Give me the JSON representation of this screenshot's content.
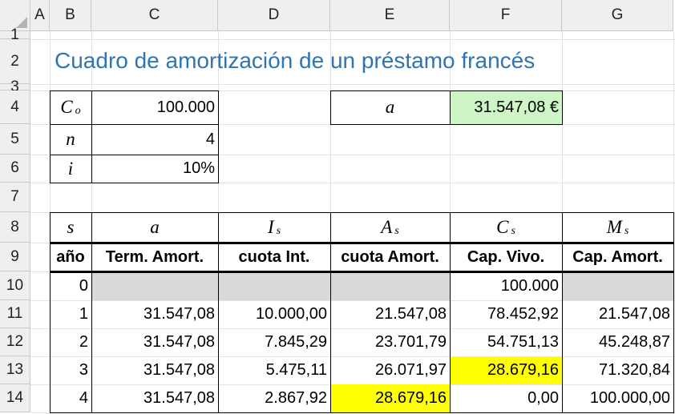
{
  "sheet": {
    "columns": [
      "A",
      "B",
      "C",
      "D",
      "E",
      "F",
      "G"
    ],
    "rows": [
      "1",
      "2",
      "3",
      "4",
      "5",
      "6",
      "7",
      "8",
      "9",
      "10",
      "11",
      "12",
      "13",
      "14"
    ],
    "title": "Cuadro de amortización de un préstamo francés",
    "params": [
      {
        "sym": "C",
        "sub": "o",
        "value": "100.000"
      },
      {
        "sym": "n",
        "sub": "",
        "value": "4"
      },
      {
        "sym": "i",
        "sub": "",
        "value": "10%"
      }
    ],
    "annuity": {
      "sym": "a",
      "value": "31.547,08 €"
    },
    "table": {
      "symbols": [
        {
          "sym": "s",
          "sub": ""
        },
        {
          "sym": "a",
          "sub": ""
        },
        {
          "sym": "I",
          "sub": "s"
        },
        {
          "sym": "A",
          "sub": "s"
        },
        {
          "sym": "C",
          "sub": "s"
        },
        {
          "sym": "M",
          "sub": "s"
        }
      ],
      "headers": [
        "año",
        "Term. Amort.",
        "cuota Int.",
        "cuota Amort.",
        "Cap. Vivo.",
        "Cap. Amort."
      ],
      "rows": [
        [
          "0",
          "",
          "",
          "",
          "100.000",
          ""
        ],
        [
          "1",
          "31.547,08",
          "10.000,00",
          "21.547,08",
          "78.452,92",
          "21.547,08"
        ],
        [
          "2",
          "31.547,08",
          "7.845,29",
          "23.701,79",
          "54.751,13",
          "45.248,87"
        ],
        [
          "3",
          "31.547,08",
          "5.475,11",
          "26.071,97",
          "28.679,16",
          "71.320,84"
        ],
        [
          "4",
          "31.547,08",
          "2.867,92",
          "28.679,16",
          "0,00",
          "100.000,00"
        ]
      ]
    }
  },
  "colors": {
    "title": "#2e75b6",
    "annuity_fill": "#cdf5c5",
    "highlight": "#ffff00",
    "gray_fill": "#d9d9d9",
    "header_bg": "#efefef"
  }
}
